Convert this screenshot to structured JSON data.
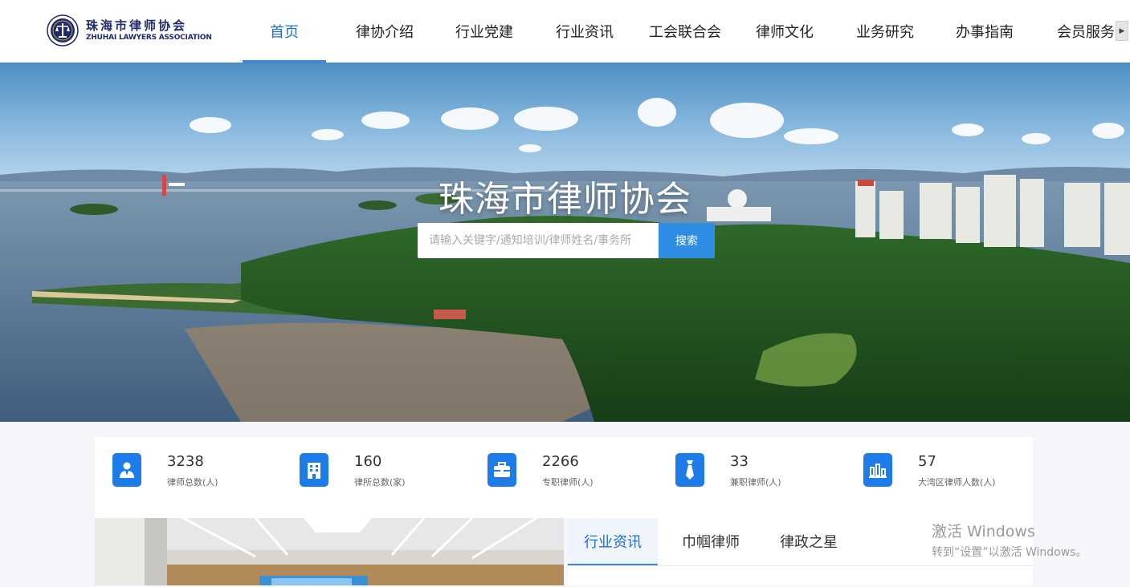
{
  "logo": {
    "name_cn": "珠海市律师协会",
    "name_en": "ZHUHAI LAWYERS ASSOCIATION",
    "emblem": "lawyers-association-emblem"
  },
  "nav": {
    "items": [
      {
        "label": "首页",
        "active": true
      },
      {
        "label": "律协介绍"
      },
      {
        "label": "行业党建"
      },
      {
        "label": "行业资讯"
      },
      {
        "label": "工会联合会"
      },
      {
        "label": "律师文化"
      },
      {
        "label": "业务研究"
      },
      {
        "label": "办事指南"
      },
      {
        "label": "会员服务"
      }
    ],
    "scroll_icon": "caret-right-icon"
  },
  "hero": {
    "title": "珠海市律师协会",
    "search_placeholder": "请输入关键字/通知培训/律师姓名/事务所",
    "search_button": "搜索"
  },
  "stats": [
    {
      "value": "3238",
      "label": "律师总数(人)",
      "icon": "lawyer-person-icon"
    },
    {
      "value": "160",
      "label": "律所总数(家)",
      "icon": "building-icon"
    },
    {
      "value": "2266",
      "label": "专职律师(人)",
      "icon": "briefcase-icon"
    },
    {
      "value": "33",
      "label": "兼职律师(人)",
      "icon": "necktie-icon"
    },
    {
      "value": "57",
      "label": "大湾区律师人数(人)",
      "icon": "bay-area-chart-icon"
    }
  ],
  "news": {
    "tabs": [
      {
        "label": "行业资讯",
        "active": true
      },
      {
        "label": "巾帼律师"
      },
      {
        "label": "律政之星"
      }
    ]
  },
  "watermark": {
    "line1": "激活 Windows",
    "line2": "转到“设置”以激活 Windows。"
  },
  "colors": {
    "accent": "#1f6fd1",
    "button": "#2f8de4",
    "icon_bg": "#1e7ce8",
    "page_bg": "#f5f6fa"
  }
}
